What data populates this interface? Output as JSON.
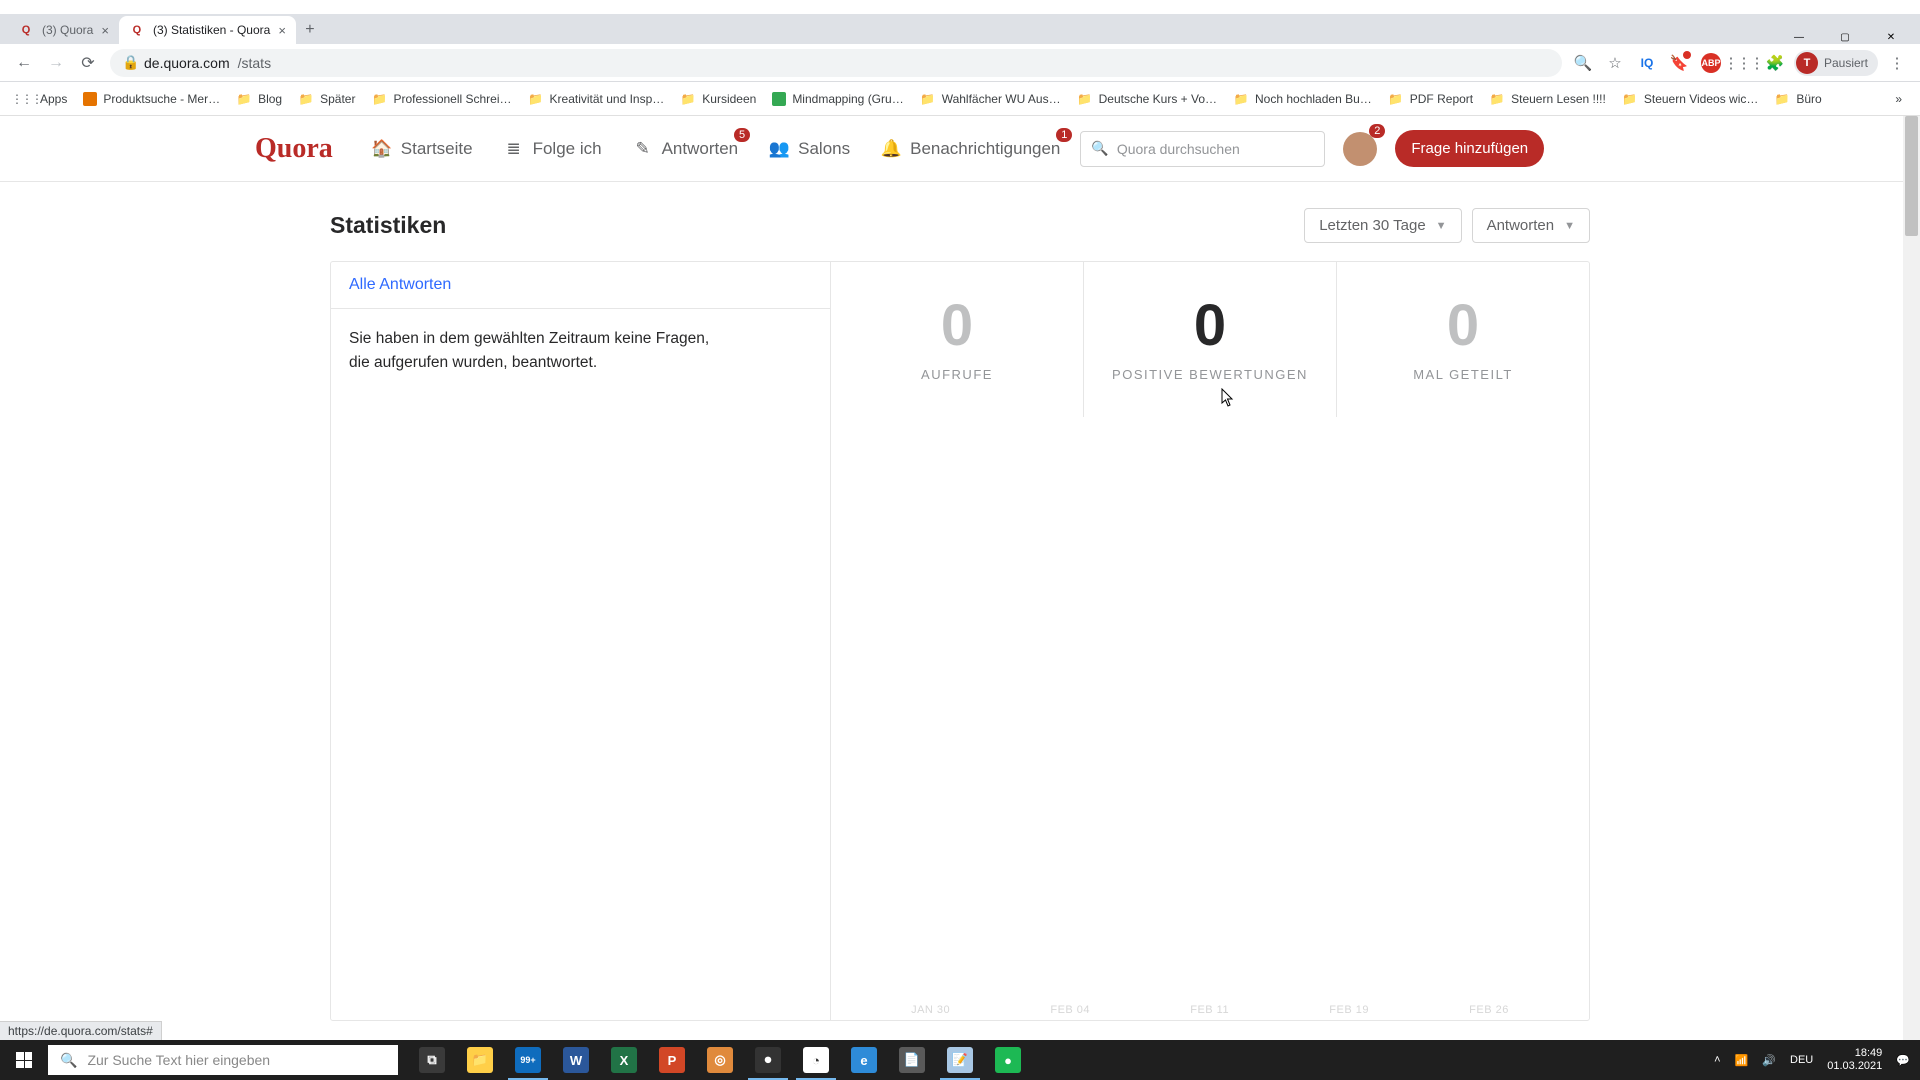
{
  "browser": {
    "tabs": [
      {
        "title": "(3) Quora",
        "active": false
      },
      {
        "title": "(3) Statistiken - Quora",
        "active": true
      }
    ],
    "url_host": "de.quora.com",
    "url_path": "/stats",
    "profile_label": "Pausiert",
    "profile_initial": "T"
  },
  "bookmarks": [
    {
      "label": "Apps",
      "kind": "grid"
    },
    {
      "label": "Produktsuche - Mer…",
      "color": "#e57300"
    },
    {
      "label": "Blog",
      "kind": "folder"
    },
    {
      "label": "Später",
      "kind": "folder"
    },
    {
      "label": "Professionell Schrei…",
      "kind": "folder"
    },
    {
      "label": "Kreativität und Insp…",
      "kind": "folder"
    },
    {
      "label": "Kursideen",
      "kind": "folder"
    },
    {
      "label": "Mindmapping   (Gru…",
      "color": "#34a853"
    },
    {
      "label": "Wahlfächer WU Aus…",
      "kind": "folder"
    },
    {
      "label": "Deutsche Kurs + Vo…",
      "kind": "folder"
    },
    {
      "label": "Noch hochladen Bu…",
      "kind": "folder"
    },
    {
      "label": "PDF Report",
      "kind": "folder"
    },
    {
      "label": "Steuern Lesen !!!!",
      "kind": "folder"
    },
    {
      "label": "Steuern Videos wic…",
      "kind": "folder"
    },
    {
      "label": "Büro",
      "kind": "folder"
    }
  ],
  "quora_nav": {
    "logo": "Quora",
    "items": [
      {
        "label": "Startseite",
        "icon_name": "home-icon"
      },
      {
        "label": "Folge ich",
        "icon_name": "list-icon"
      },
      {
        "label": "Antworten",
        "icon_name": "edit-icon",
        "badge": "5"
      },
      {
        "label": "Salons",
        "icon_name": "people-icon"
      },
      {
        "label": "Benachrichtigungen",
        "icon_name": "bell-icon",
        "badge": "1"
      }
    ],
    "search_placeholder": "Quora durchsuchen",
    "profile_badge": "2",
    "ask_button": "Frage hinzufügen"
  },
  "page": {
    "title": "Statistiken",
    "filter_range": "Letzten 30 Tage",
    "filter_type": "Antworten",
    "left_header": "Alle Antworten",
    "empty_msg": "Sie haben in dem gewählten Zeitraum keine Fragen, die aufgerufen wurden, beantwortet.",
    "metrics": [
      {
        "value": "0",
        "label": "AUFRUFE",
        "selected": false
      },
      {
        "value": "0",
        "label": "POSITIVE BEWERTUNGEN",
        "selected": true
      },
      {
        "value": "0",
        "label": "MAL GETEILT",
        "selected": false
      }
    ],
    "xaxis": [
      "JAN 30",
      "FEB 04",
      "FEB 11",
      "FEB 19",
      "FEB 26"
    ],
    "status_url": "https://de.quora.com/stats#"
  },
  "taskbar": {
    "search_placeholder": "Zur Suche Text hier eingeben",
    "apps": [
      {
        "name": "task-view",
        "color": "#3a3a3a",
        "glyph": "⧉"
      },
      {
        "name": "file-explorer",
        "color": "#ffcf48",
        "glyph": "📁"
      },
      {
        "name": "mail",
        "color": "#0f6cbd",
        "glyph": "99+",
        "active": true
      },
      {
        "name": "word",
        "color": "#2b579a",
        "glyph": "W"
      },
      {
        "name": "excel",
        "color": "#217346",
        "glyph": "X"
      },
      {
        "name": "powerpoint",
        "color": "#d24726",
        "glyph": "P"
      },
      {
        "name": "brave",
        "color": "#e08a3c",
        "glyph": "◎"
      },
      {
        "name": "obs",
        "color": "#333333",
        "glyph": "⏺",
        "active": true
      },
      {
        "name": "chrome",
        "color": "#ffffff",
        "glyph": "◔",
        "active": true
      },
      {
        "name": "edge",
        "color": "#2e8bd8",
        "glyph": "e"
      },
      {
        "name": "reader",
        "color": "#5a5a5a",
        "glyph": "📄"
      },
      {
        "name": "notepad",
        "color": "#a8c7e4",
        "glyph": "📝",
        "active": true
      },
      {
        "name": "spotify",
        "color": "#1db954",
        "glyph": "●"
      }
    ],
    "lang": "DEU",
    "time": "18:49",
    "date": "01.03.2021"
  },
  "chart_data": {
    "type": "bar",
    "title": "",
    "xlabel": "",
    "ylabel": "",
    "categories": [
      "JAN 30",
      "FEB 04",
      "FEB 11",
      "FEB 19",
      "FEB 26"
    ],
    "series": [
      {
        "name": "Aufrufe",
        "values": [
          0,
          0,
          0,
          0,
          0
        ]
      },
      {
        "name": "Positive Bewertungen",
        "values": [
          0,
          0,
          0,
          0,
          0
        ]
      },
      {
        "name": "Mal geteilt",
        "values": [
          0,
          0,
          0,
          0,
          0
        ]
      }
    ],
    "ylim": [
      0,
      1
    ]
  }
}
